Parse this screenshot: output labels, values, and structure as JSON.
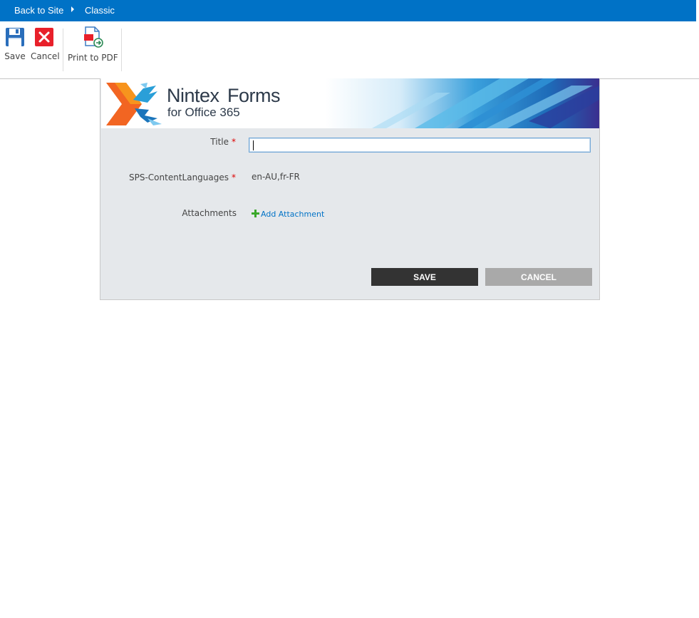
{
  "topbar": {
    "back_label": "Back to Site",
    "classic_label": "Classic",
    "bg_color": "#0072c6"
  },
  "ribbon": {
    "save_label": "Save",
    "cancel_label": "Cancel",
    "print_label": "Print to PDF",
    "icons": [
      "floppy-disk-icon",
      "close-icon",
      "print-pdf-icon"
    ]
  },
  "banner": {
    "brand": "Nintex",
    "product": "Forms",
    "subtitle": "for Office 365"
  },
  "form": {
    "title_label": "Title",
    "title_value": "",
    "content_lang_label": "SPS-ContentLanguages",
    "content_lang_value": "en-AU,fr-FR",
    "attachments_label": "Attachments",
    "add_attachment_label": "Add Attachment",
    "required_marker": "*",
    "save_button": "SAVE",
    "cancel_button": "CANCEL"
  }
}
